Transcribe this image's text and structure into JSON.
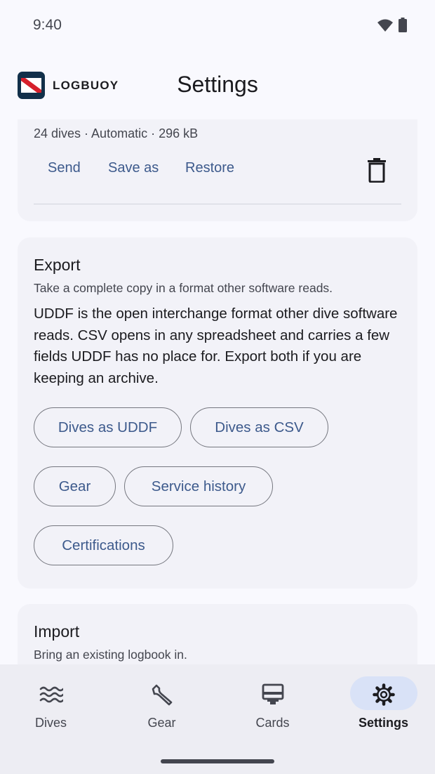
{
  "status": {
    "time": "9:40"
  },
  "app": {
    "brand": "LOGBUOY",
    "title": "Settings"
  },
  "backup": {
    "meta": "24 dives · Automatic · 296 kB",
    "actions": [
      "Send",
      "Save as",
      "Restore"
    ]
  },
  "export": {
    "title": "Export",
    "subtitle": "Take a complete copy in a format other software reads.",
    "body": "UDDF is the open interchange format other dive software reads. CSV opens in any spreadsheet and carries a few fields UDDF has no place for. Export both if you are keeping an archive.",
    "buttons": [
      "Dives as UDDF",
      "Dives as CSV",
      "Gear",
      "Service history",
      "Certifications"
    ]
  },
  "import": {
    "title": "Import",
    "subtitle": "Bring an existing logbook in."
  },
  "nav": {
    "items": [
      {
        "label": "Dives",
        "icon": "waves-icon"
      },
      {
        "label": "Gear",
        "icon": "wrench-icon"
      },
      {
        "label": "Cards",
        "icon": "card-icon"
      },
      {
        "label": "Settings",
        "icon": "gear-icon"
      }
    ],
    "active": "Settings"
  },
  "colors": {
    "accent": "#3d5a8c",
    "active_pill": "#d9e2f7",
    "logo_bg": "#12304a",
    "flag_red": "#d6202b"
  }
}
